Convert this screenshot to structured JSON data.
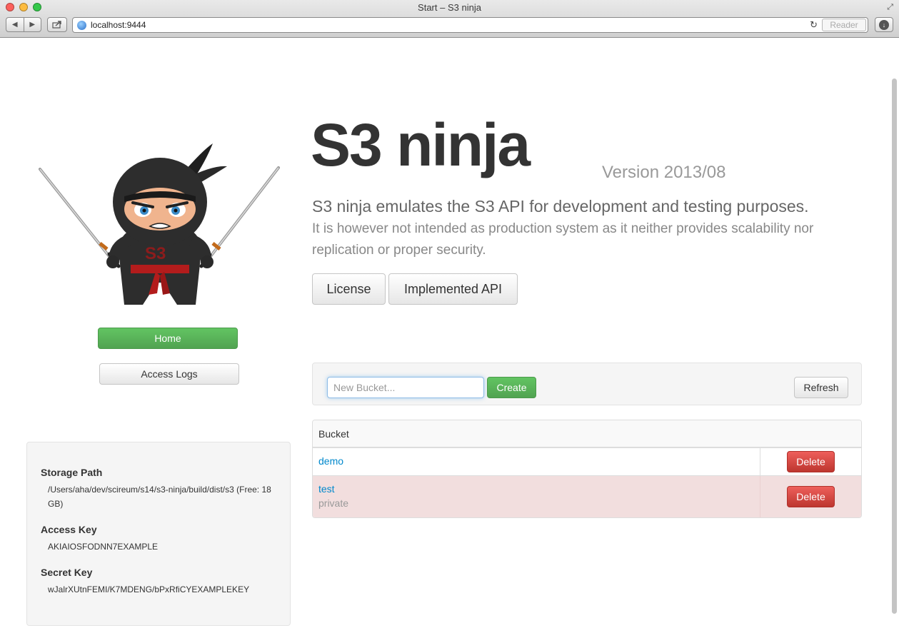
{
  "window": {
    "title": "Start – S3 ninja",
    "url": "localhost:9444",
    "reader_label": "Reader"
  },
  "sidebar": {
    "home_label": "Home",
    "access_logs_label": "Access Logs",
    "info": {
      "storage_path_label": "Storage Path",
      "storage_path_value": "/Users/aha/dev/scireum/s14/s3-ninja/build/dist/s3 (Free: 18 GB)",
      "access_key_label": "Access Key",
      "access_key_value": "AKIAIOSFODNN7EXAMPLE",
      "secret_key_label": "Secret Key",
      "secret_key_value": "wJalrXUtnFEMI/K7MDENG/bPxRfiCYEXAMPLEKEY"
    }
  },
  "header": {
    "title": "S3 ninja",
    "version": "Version 2013/08",
    "lead": "S3 ninja emulates the S3 API for development and testing purposes.",
    "description": "It is however not intended as production system as it neither provides scalability nor replication or proper security.",
    "license_label": "License",
    "api_label": "Implemented API"
  },
  "buckets": {
    "input_placeholder": "New Bucket...",
    "create_label": "Create",
    "refresh_label": "Refresh",
    "column_header": "Bucket",
    "rows": [
      {
        "name": "demo",
        "note": "",
        "delete_label": "Delete"
      },
      {
        "name": "test",
        "note": "private",
        "delete_label": "Delete"
      }
    ]
  },
  "colors": {
    "success": "#5bb75b",
    "danger": "#da4f49",
    "link": "#0088cc",
    "danger_row": "#f2dede"
  },
  "icons": [
    "back-icon",
    "forward-icon",
    "share-icon",
    "globe-icon",
    "reload-icon",
    "download-icon",
    "fullscreen-icon"
  ]
}
